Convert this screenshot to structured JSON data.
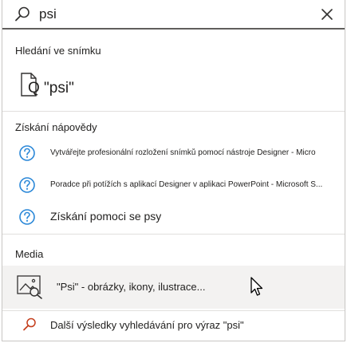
{
  "search": {
    "value": "psi",
    "placeholder": ""
  },
  "slide_search": {
    "heading": "Hledání ve snímku",
    "result_label": "Q \"psi\""
  },
  "help": {
    "heading": "Získání nápovědy",
    "items": [
      {
        "label": "Vytvářejte profesionální rozložení snímků pomocí nástroje Designer - Micro"
      },
      {
        "label": "Poradce při potížích s aplikací Designer v aplikaci PowerPoint - Microsoft S..."
      },
      {
        "label": "Získání pomoci se psy"
      }
    ]
  },
  "media": {
    "heading": "Media",
    "items": [
      {
        "label": "\"Psi\" - obrázky, ikony, ilustrace..."
      }
    ]
  },
  "more_results": {
    "label": "Další výsledky vyhledávání pro výraz \"psi\""
  },
  "colors": {
    "accent_orange": "#c43e1c",
    "help_blue": "#2b88d8",
    "hover_bg": "#f3f2f1"
  },
  "icons": {
    "search": "search-icon",
    "clear": "close-icon",
    "slide_search": "document-search-icon",
    "help": "question-circle-icon",
    "media": "image-search-icon",
    "more": "search-icon"
  }
}
